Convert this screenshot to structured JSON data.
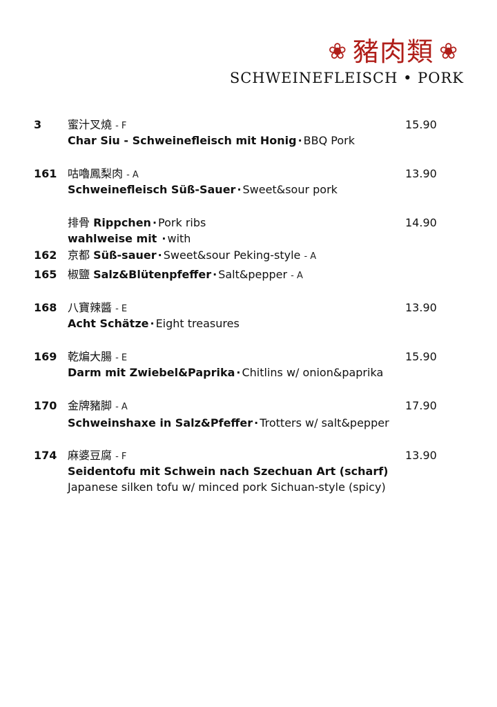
{
  "header": {
    "flower_left": "❀",
    "title_zh": "豬肉類",
    "flower_right": "❀",
    "title_en": "SCHWEINEFLEISCH • PORK"
  },
  "items": [
    {
      "num": "3",
      "zh": "蜜汁叉燒",
      "code": "- F",
      "price": "15.90",
      "de": "Char Siu - Schweinefleisch mit Honig",
      "sep": "·",
      "en": "BBQ Pork"
    },
    {
      "num": "161",
      "zh": "咕嚕鳳梨肉",
      "code": "- A",
      "price": "13.90",
      "de": "Schweinefleisch Süß-Sauer",
      "sep": "·",
      "en": "Sweet&sour pork"
    },
    {
      "zh": "排骨",
      "de": "Rippchen",
      "sep": "·",
      "en": "Pork ribs",
      "price": "14.90",
      "sub_de": "wahlweise mit",
      "sub_sep": "·",
      "sub_en": "with"
    },
    {
      "num": "162",
      "zh": "京都",
      "de": "Süß-sauer",
      "sep": "·",
      "en": "Sweet&sour Peking-style",
      "code": "- A"
    },
    {
      "num": "165",
      "zh": "椒鹽",
      "de": "Salz&Blütenpfeffer",
      "sep": "·",
      "en": "Salt&pepper",
      "code": "- A"
    },
    {
      "num": "168",
      "zh": "八寶辣醬",
      "code": "- E",
      "price": "13.90",
      "de": "Acht Schätze",
      "sep": "·",
      "en": "Eight treasures"
    },
    {
      "num": "169",
      "zh": "乾煸大腸",
      "code": "- E",
      "price": "15.90",
      "de": "Darm mit Zwiebel&Paprika",
      "sep": "·",
      "en": "Chitlins w/ onion&paprika"
    },
    {
      "num": "170",
      "zh": "金牌豬脚",
      "code": "- A",
      "price": "17.90",
      "de": "Schweinshaxe in Salz&Pfeffer",
      "sep": "·",
      "en": "Trotters w/ salt&pepper"
    },
    {
      "num": "174",
      "zh": "麻婆豆腐",
      "code": "- F",
      "price": "13.90",
      "de": "Seidentofu mit Schwein nach Szechuan Art (scharf)",
      "en2": "Japanese silken tofu w/ minced pork Sichuan-style (spicy)"
    }
  ]
}
